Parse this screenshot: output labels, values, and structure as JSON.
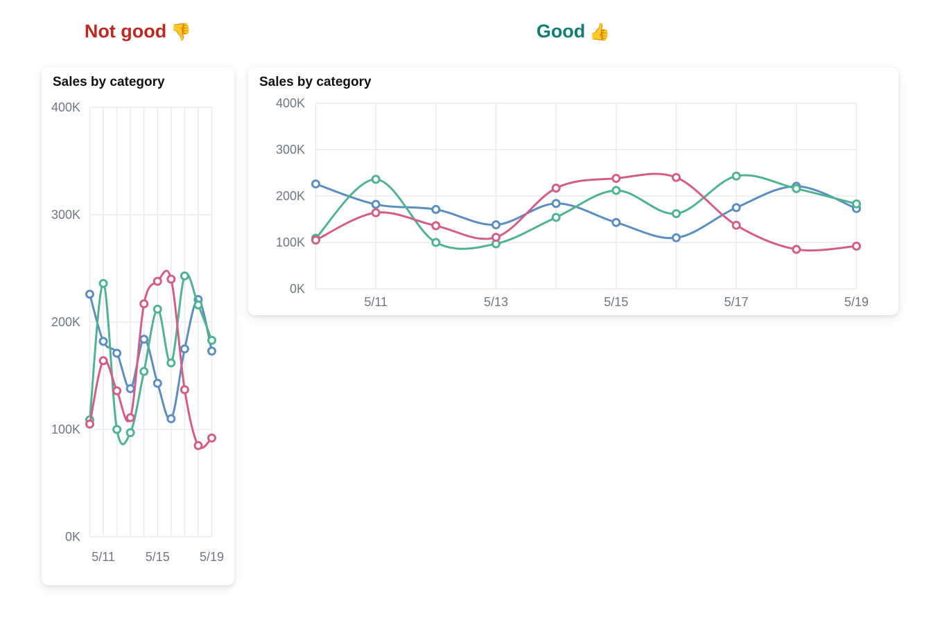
{
  "headings": {
    "bad": {
      "label": "Not good",
      "emoji": "👎",
      "color": "#bb2a22"
    },
    "good": {
      "label": "Good",
      "emoji": "👍",
      "color": "#0f7d73"
    }
  },
  "colors": {
    "grid": "#e9eaee",
    "tick_text": "#707585",
    "series": [
      "#5b8ebf",
      "#51b28f",
      "#d25e87"
    ]
  },
  "chart_data": [
    {
      "panel": "Not good",
      "type": "line",
      "title": "Sales by category",
      "x": [
        "5/10",
        "5/11",
        "5/12",
        "5/13",
        "5/14",
        "5/15",
        "5/16",
        "5/17",
        "5/18",
        "5/19"
      ],
      "xtick_labels": [
        "5/11",
        "5/15",
        "5/19"
      ],
      "yticks": [
        "0K",
        "100K",
        "200K",
        "300K",
        "400K"
      ],
      "ylim": [
        0,
        400000
      ],
      "grid": true,
      "curve": "smooth",
      "series": [
        {
          "values": [
            226000,
            182000,
            171000,
            138000,
            184000,
            143000,
            110000,
            175000,
            221000,
            173000
          ]
        },
        {
          "values": [
            109000,
            236000,
            100000,
            97000,
            154000,
            212000,
            162000,
            243000,
            216000,
            183000
          ]
        },
        {
          "values": [
            105000,
            164000,
            136000,
            111000,
            217000,
            238000,
            240000,
            137000,
            85000,
            92000
          ]
        }
      ]
    },
    {
      "panel": "Good",
      "type": "line",
      "title": "Sales by category",
      "x": [
        "5/10",
        "5/11",
        "5/12",
        "5/13",
        "5/14",
        "5/15",
        "5/16",
        "5/17",
        "5/18",
        "5/19"
      ],
      "xtick_labels": [
        "5/11",
        "5/13",
        "5/15",
        "5/17",
        "5/19"
      ],
      "yticks": [
        "0K",
        "100K",
        "200K",
        "300K",
        "400K"
      ],
      "ylim": [
        0,
        400000
      ],
      "grid": true,
      "curve": "smooth",
      "series": [
        {
          "values": [
            226000,
            182000,
            171000,
            138000,
            184000,
            143000,
            110000,
            175000,
            221000,
            173000
          ]
        },
        {
          "values": [
            109000,
            236000,
            100000,
            97000,
            154000,
            212000,
            162000,
            243000,
            216000,
            183000
          ]
        },
        {
          "values": [
            105000,
            164000,
            136000,
            111000,
            217000,
            238000,
            240000,
            137000,
            85000,
            92000
          ]
        }
      ]
    }
  ]
}
